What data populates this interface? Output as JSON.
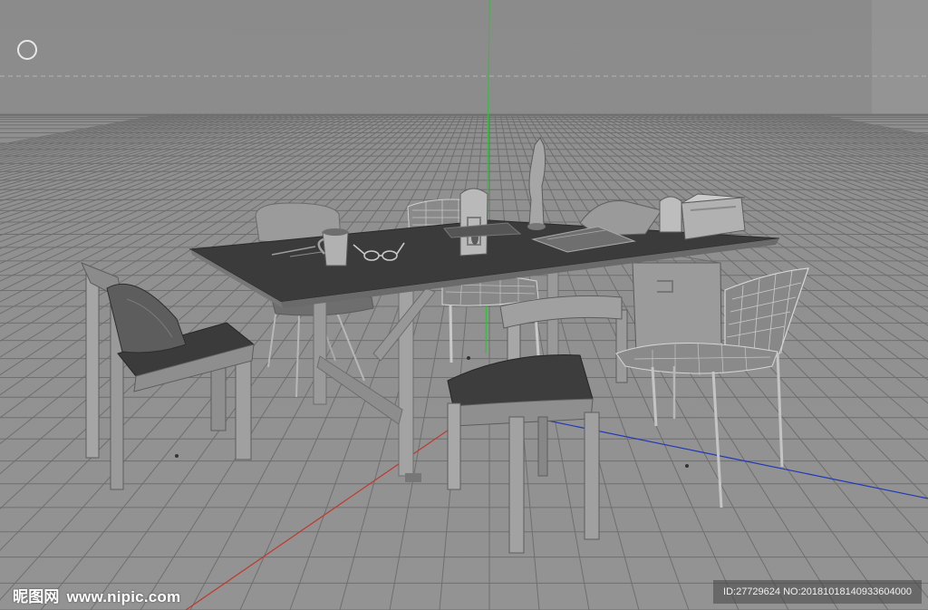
{
  "viewport": {
    "colors": {
      "background": "#8e8e8e",
      "grid": "#6f6f6f",
      "axis_x": "#c0392b",
      "axis_y": "#2ecc40",
      "axis_z": "#1f3fbf",
      "table_top": "#3a3a3a",
      "object_light": "#a0a0a0",
      "object_dark": "#5e5e5e"
    },
    "camera_nav_icon": "orbit-circle-icon"
  },
  "watermark": {
    "logo_text": "昵图网",
    "site": "www.nipic.com",
    "id_text": "ID:27729624 NO:20181018140933604000"
  }
}
